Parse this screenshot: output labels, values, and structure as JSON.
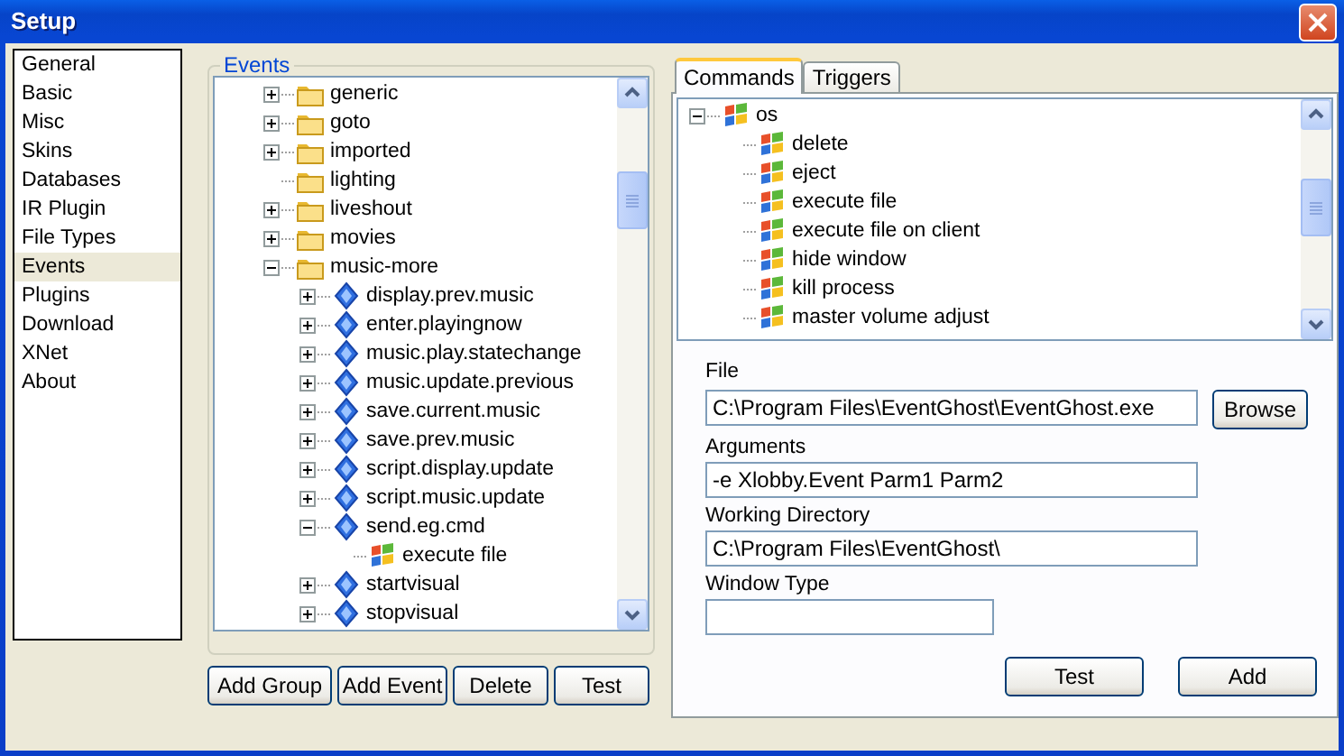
{
  "window": {
    "title": "Setup"
  },
  "sidebar": {
    "items": [
      {
        "label": "General",
        "selected": false
      },
      {
        "label": "Basic",
        "selected": false
      },
      {
        "label": "Misc",
        "selected": false
      },
      {
        "label": "Skins",
        "selected": false
      },
      {
        "label": "Databases",
        "selected": false
      },
      {
        "label": "IR Plugin",
        "selected": false
      },
      {
        "label": "File Types",
        "selected": false
      },
      {
        "label": "Events",
        "selected": true
      },
      {
        "label": "Plugins",
        "selected": false
      },
      {
        "label": "Download",
        "selected": false
      },
      {
        "label": "XNet",
        "selected": false
      },
      {
        "label": "About",
        "selected": false
      }
    ]
  },
  "events": {
    "title": "Events",
    "tree": [
      {
        "label": "generic",
        "kind": "folder",
        "expanded": false
      },
      {
        "label": "goto",
        "kind": "folder",
        "expanded": false
      },
      {
        "label": "imported",
        "kind": "folder",
        "expanded": false
      },
      {
        "label": "lighting",
        "kind": "folder"
      },
      {
        "label": "liveshout",
        "kind": "folder",
        "expanded": false
      },
      {
        "label": "movies",
        "kind": "folder",
        "expanded": false
      },
      {
        "label": "music-more",
        "kind": "folder",
        "expanded": true,
        "children": [
          {
            "label": "display.prev.music",
            "kind": "event",
            "expanded": false
          },
          {
            "label": "enter.playingnow",
            "kind": "event",
            "expanded": false
          },
          {
            "label": "music.play.statechange",
            "kind": "event",
            "expanded": false
          },
          {
            "label": "music.update.previous",
            "kind": "event",
            "expanded": false
          },
          {
            "label": "save.current.music",
            "kind": "event",
            "expanded": false
          },
          {
            "label": "save.prev.music",
            "kind": "event",
            "expanded": false
          },
          {
            "label": "script.display.update",
            "kind": "event",
            "expanded": false
          },
          {
            "label": "script.music.update",
            "kind": "event",
            "expanded": false
          },
          {
            "label": "send.eg.cmd",
            "kind": "event",
            "expanded": true,
            "children": [
              {
                "label": "execute file",
                "kind": "command"
              }
            ]
          },
          {
            "label": "startvisual",
            "kind": "event",
            "expanded": false
          },
          {
            "label": "stopvisual",
            "kind": "event",
            "expanded": false
          }
        ]
      }
    ],
    "buttons": [
      "Add Group",
      "Add Event",
      "Delete",
      "Test"
    ]
  },
  "tabs": [
    {
      "label": "Commands",
      "selected": true
    },
    {
      "label": "Triggers",
      "selected": false
    }
  ],
  "commands": {
    "tree": [
      {
        "label": "os",
        "kind": "command",
        "expanded": true,
        "children": [
          {
            "label": "delete",
            "kind": "command"
          },
          {
            "label": "eject",
            "kind": "command"
          },
          {
            "label": "execute file",
            "kind": "command"
          },
          {
            "label": "execute file on client",
            "kind": "command"
          },
          {
            "label": "hide window",
            "kind": "command"
          },
          {
            "label": "kill process",
            "kind": "command"
          },
          {
            "label": "master volume adjust",
            "kind": "command"
          }
        ]
      }
    ]
  },
  "form": {
    "fields": [
      {
        "label": "File",
        "value": "C:\\Program Files\\EventGhost\\EventGhost.exe",
        "button": "Browse"
      },
      {
        "label": "Arguments",
        "value": "-e Xlobby.Event Parm1 Parm2"
      },
      {
        "label": "Working Directory",
        "value": "C:\\Program Files\\EventGhost\\"
      },
      {
        "label": "Window Type"
      }
    ],
    "buttons": [
      "Test",
      "Add"
    ]
  }
}
